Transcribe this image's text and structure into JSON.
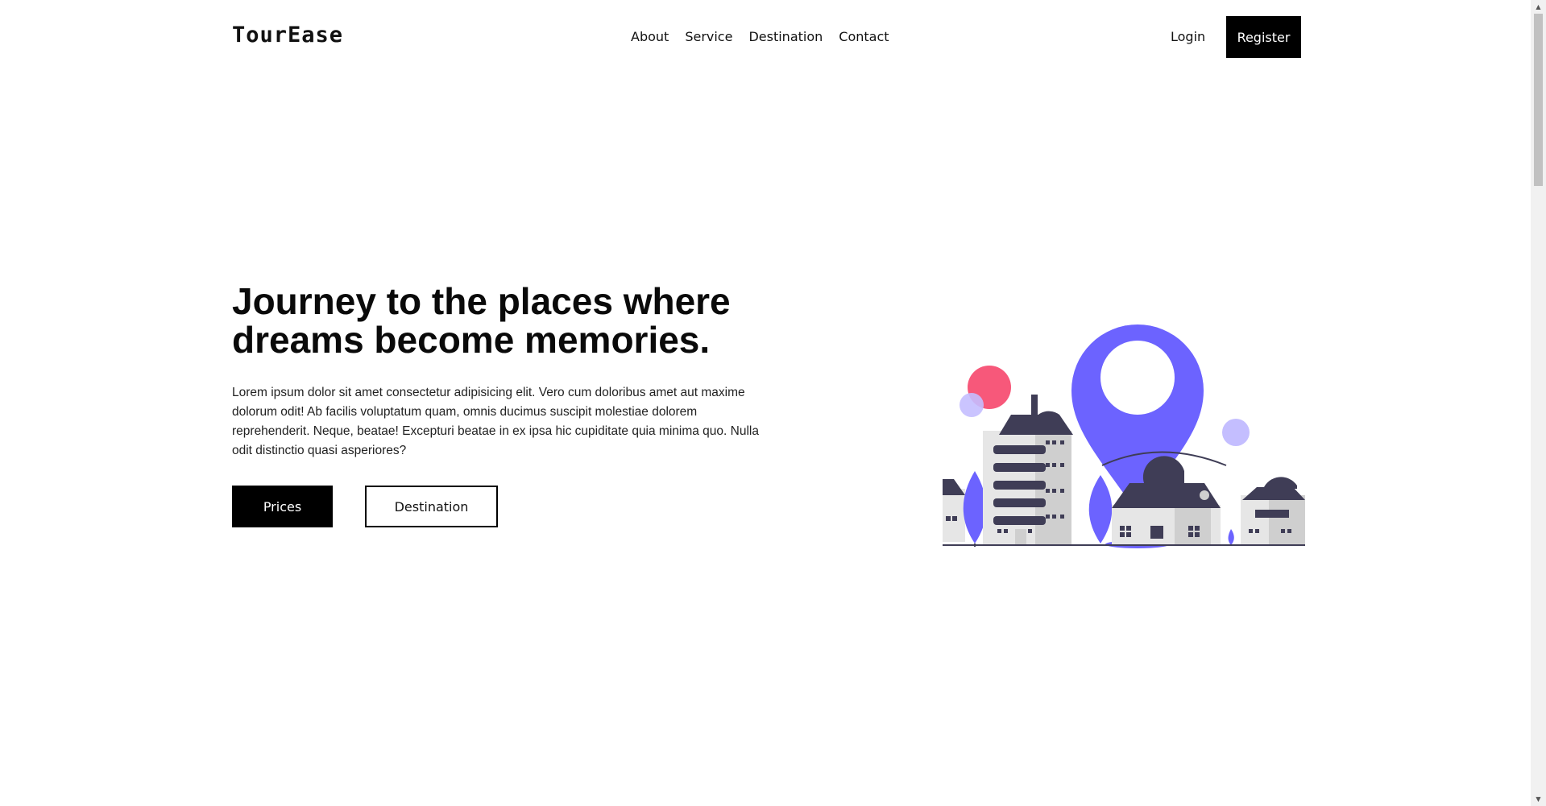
{
  "header": {
    "logo": "TourEase",
    "nav": [
      "About",
      "Service",
      "Destination",
      "Contact"
    ],
    "login_label": "Login",
    "register_label": "Register"
  },
  "hero": {
    "title": "Journey to the places where dreams become memories.",
    "text": "Lorem ipsum dolor sit amet consectetur adipisicing elit. Vero cum doloribus amet aut maxime dolorum odit! Ab facilis voluptatum quam, omnis ducimus suscipit molestiae dolorem reprehenderit. Neque, beatae! Excepturi beatae in ex ipsa hic cupiditate quia minima quo. Nulla odit distinctio quasi asperiores?",
    "primary_button": "Prices",
    "secondary_button": "Destination"
  },
  "colors": {
    "accent": "#6c63ff",
    "dark": "#3f3d56",
    "pink": "#f7587a",
    "lavender": "#c4beff",
    "gray": "#d0d0d0"
  },
  "scrollbar": {
    "up_icon": "arrow-up-icon",
    "down_icon": "arrow-down-icon"
  }
}
